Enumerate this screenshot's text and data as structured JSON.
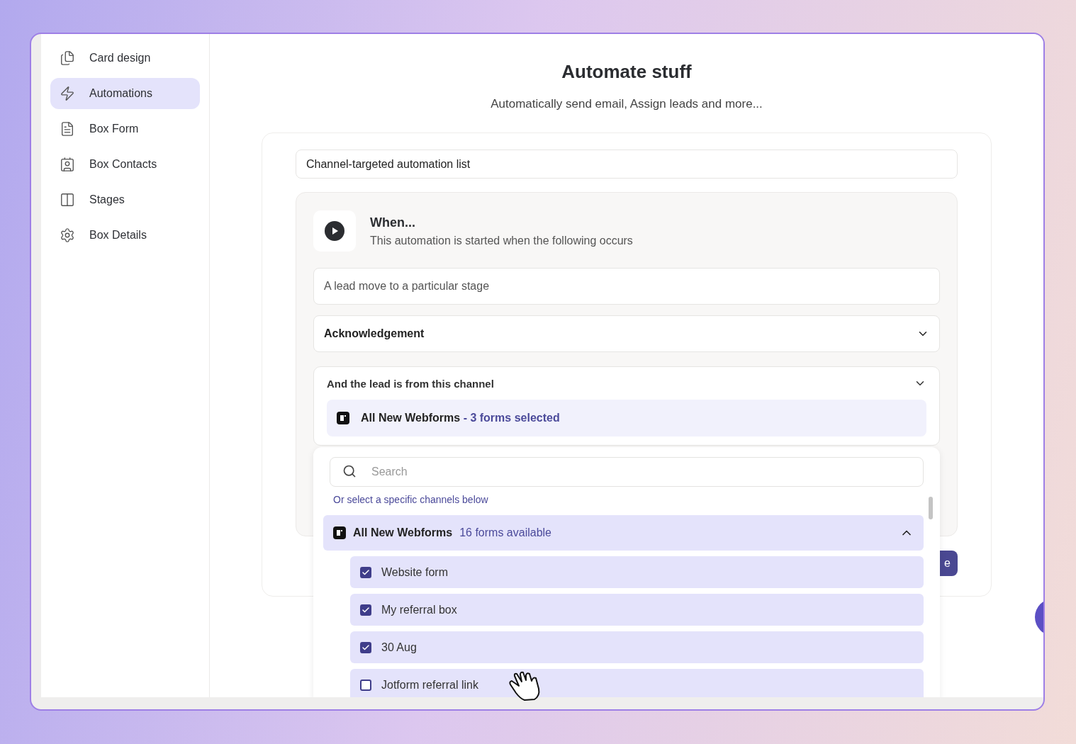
{
  "sidebar": {
    "items": [
      {
        "label": "Card design",
        "selected": false
      },
      {
        "label": "Automations",
        "selected": true
      },
      {
        "label": "Box Form",
        "selected": false
      },
      {
        "label": "Box Contacts",
        "selected": false
      },
      {
        "label": "Stages",
        "selected": false
      },
      {
        "label": "Box Details",
        "selected": false
      }
    ]
  },
  "header": {
    "title": "Automate stuff",
    "subtitle": "Automatically send email, Assign leads and more..."
  },
  "automation": {
    "name": "Channel-targeted automation list",
    "trigger": {
      "title": "When...",
      "description": "This automation is started when the following occurs",
      "event": "A lead move to a particular stage",
      "stage": "Acknowledgement",
      "channel": {
        "label": "And the lead is from this channel",
        "source": "All New Webforms",
        "summary": "- 3 forms selected",
        "expanded": true
      }
    },
    "save_button": "e"
  },
  "dropdown": {
    "search": {
      "placeholder": "Search"
    },
    "hint": "Or select a specific channels below",
    "group": {
      "name": "All New Webforms",
      "count": "16 forms available",
      "expanded": true,
      "items": [
        {
          "label": "Website form",
          "checked": true
        },
        {
          "label": "My referral box",
          "checked": true
        },
        {
          "label": "30 Aug",
          "checked": true
        },
        {
          "label": "Jotform referral link",
          "checked": false
        }
      ]
    }
  }
}
